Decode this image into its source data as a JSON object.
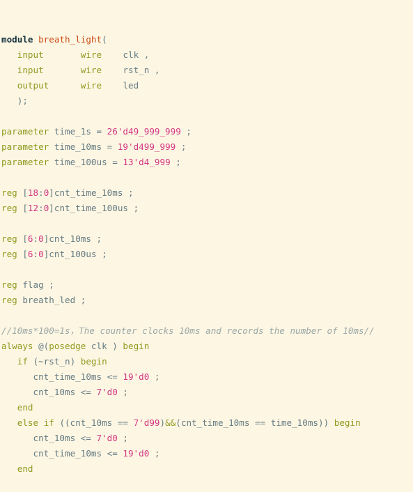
{
  "editor": {
    "language": "verilog",
    "theme": "solarized-light",
    "background_color": "#fdf6e3",
    "default_text_color": "#657b83",
    "font_size_px": 12.6,
    "line_height_px": 22,
    "palette": {
      "keyword": "#8f9a1e",
      "keyword_strong": "#17343f",
      "number": "#d33682",
      "module_name": "#cb4b16",
      "comment": "#9aa7a7",
      "operator": "#657b83",
      "punctuation": "#657b83"
    }
  },
  "code": {
    "plain_text": "module breath_light(\n   input       wire    clk ,\n   input       wire    rst_n ,\n   output      wire    led\n   );\n\nparameter time_1s = 26'd49_999_999 ;\nparameter time_10ms = 19'd499_999 ;\nparameter time_100us = 13'd4_999 ;\n\nreg [18:0]cnt_time_10ms ;\nreg [12:0]cnt_time_100us ;\n\nreg [6:0]cnt_10ms ;\nreg [6:0]cnt_100us ;\n\nreg flag ;\nreg breath_led ;\n\n//10ms*100=1s，The counter clocks 10ms and records the number of 10ms//\nalways @(posedge clk ) begin\n   if (~rst_n) begin\n      cnt_time_10ms <= 19'd0 ;\n      cnt_10ms <= 7'd0 ;\n   end\n   else if ((cnt_10ms == 7'd99)&&(cnt_time_10ms == time_10ms)) begin\n      cnt_10ms <= 7'd0 ;\n      cnt_time_10ms <= 19'd0 ;\n   end",
    "lines": [
      {
        "n": 1,
        "tokens": [
          {
            "t": "module",
            "c": "kw-strong"
          },
          {
            "t": " ",
            "c": "plain"
          },
          {
            "t": "breath_light",
            "c": "fn"
          },
          {
            "t": "(",
            "c": "punct"
          }
        ]
      },
      {
        "n": 2,
        "tokens": [
          {
            "t": "   ",
            "c": "plain"
          },
          {
            "t": "input",
            "c": "kw"
          },
          {
            "t": "       ",
            "c": "plain"
          },
          {
            "t": "wire",
            "c": "kw"
          },
          {
            "t": "    ",
            "c": "plain"
          },
          {
            "t": "clk ,",
            "c": "plain"
          }
        ]
      },
      {
        "n": 3,
        "tokens": [
          {
            "t": "   ",
            "c": "plain"
          },
          {
            "t": "input",
            "c": "kw"
          },
          {
            "t": "       ",
            "c": "plain"
          },
          {
            "t": "wire",
            "c": "kw"
          },
          {
            "t": "    ",
            "c": "plain"
          },
          {
            "t": "rst_n ,",
            "c": "plain"
          }
        ]
      },
      {
        "n": 4,
        "tokens": [
          {
            "t": "   ",
            "c": "plain"
          },
          {
            "t": "output",
            "c": "kw"
          },
          {
            "t": "      ",
            "c": "plain"
          },
          {
            "t": "wire",
            "c": "kw"
          },
          {
            "t": "    ",
            "c": "plain"
          },
          {
            "t": "led",
            "c": "plain"
          }
        ]
      },
      {
        "n": 5,
        "tokens": [
          {
            "t": "   );",
            "c": "plain"
          }
        ]
      },
      {
        "n": 6,
        "tokens": []
      },
      {
        "n": 7,
        "tokens": [
          {
            "t": "parameter",
            "c": "kw"
          },
          {
            "t": " time_1s = ",
            "c": "plain"
          },
          {
            "t": "26'd49_999_999",
            "c": "num"
          },
          {
            "t": " ;",
            "c": "plain"
          }
        ]
      },
      {
        "n": 8,
        "tokens": [
          {
            "t": "parameter",
            "c": "kw"
          },
          {
            "t": " time_10ms = ",
            "c": "plain"
          },
          {
            "t": "19'd499_999",
            "c": "num"
          },
          {
            "t": " ;",
            "c": "plain"
          }
        ]
      },
      {
        "n": 9,
        "tokens": [
          {
            "t": "parameter",
            "c": "kw"
          },
          {
            "t": " time_100us = ",
            "c": "plain"
          },
          {
            "t": "13'd4_999",
            "c": "num"
          },
          {
            "t": " ;",
            "c": "plain"
          }
        ]
      },
      {
        "n": 10,
        "tokens": []
      },
      {
        "n": 11,
        "tokens": [
          {
            "t": "reg",
            "c": "kw"
          },
          {
            "t": " [",
            "c": "plain"
          },
          {
            "t": "18",
            "c": "num"
          },
          {
            "t": ":",
            "c": "plain"
          },
          {
            "t": "0",
            "c": "num"
          },
          {
            "t": "]cnt_time_10ms ;",
            "c": "plain"
          }
        ]
      },
      {
        "n": 12,
        "tokens": [
          {
            "t": "reg",
            "c": "kw"
          },
          {
            "t": " [",
            "c": "plain"
          },
          {
            "t": "12",
            "c": "num"
          },
          {
            "t": ":",
            "c": "plain"
          },
          {
            "t": "0",
            "c": "num"
          },
          {
            "t": "]cnt_time_100us ;",
            "c": "plain"
          }
        ]
      },
      {
        "n": 13,
        "tokens": []
      },
      {
        "n": 14,
        "tokens": [
          {
            "t": "reg",
            "c": "kw"
          },
          {
            "t": " [",
            "c": "plain"
          },
          {
            "t": "6",
            "c": "num"
          },
          {
            "t": ":",
            "c": "plain"
          },
          {
            "t": "0",
            "c": "num"
          },
          {
            "t": "]cnt_10ms ;",
            "c": "plain"
          }
        ]
      },
      {
        "n": 15,
        "tokens": [
          {
            "t": "reg",
            "c": "kw"
          },
          {
            "t": " [",
            "c": "plain"
          },
          {
            "t": "6",
            "c": "num"
          },
          {
            "t": ":",
            "c": "plain"
          },
          {
            "t": "0",
            "c": "num"
          },
          {
            "t": "]cnt_100us ;",
            "c": "plain"
          }
        ]
      },
      {
        "n": 16,
        "tokens": []
      },
      {
        "n": 17,
        "tokens": [
          {
            "t": "reg",
            "c": "kw"
          },
          {
            "t": " flag ;",
            "c": "plain"
          }
        ]
      },
      {
        "n": 18,
        "tokens": [
          {
            "t": "reg",
            "c": "kw"
          },
          {
            "t": " breath_led ;",
            "c": "plain"
          }
        ]
      },
      {
        "n": 19,
        "tokens": []
      },
      {
        "n": 20,
        "tokens": [
          {
            "t": "//10ms*100=1s，The counter clocks 10ms and records the number of 10ms//",
            "c": "comment"
          }
        ]
      },
      {
        "n": 21,
        "tokens": [
          {
            "t": "always",
            "c": "kw"
          },
          {
            "t": " @(",
            "c": "plain"
          },
          {
            "t": "posedge",
            "c": "kw"
          },
          {
            "t": " clk ) ",
            "c": "plain"
          },
          {
            "t": "begin",
            "c": "kw"
          }
        ]
      },
      {
        "n": 22,
        "tokens": [
          {
            "t": "   ",
            "c": "plain"
          },
          {
            "t": "if",
            "c": "kw"
          },
          {
            "t": " (~rst_n) ",
            "c": "plain"
          },
          {
            "t": "begin",
            "c": "kw"
          }
        ]
      },
      {
        "n": 23,
        "tokens": [
          {
            "t": "      cnt_time_10ms <= ",
            "c": "plain"
          },
          {
            "t": "19'd0",
            "c": "num"
          },
          {
            "t": " ;",
            "c": "plain"
          }
        ]
      },
      {
        "n": 24,
        "tokens": [
          {
            "t": "      cnt_10ms <= ",
            "c": "plain"
          },
          {
            "t": "7'd0",
            "c": "num"
          },
          {
            "t": " ;",
            "c": "plain"
          }
        ]
      },
      {
        "n": 25,
        "tokens": [
          {
            "t": "   ",
            "c": "plain"
          },
          {
            "t": "end",
            "c": "kw"
          }
        ]
      },
      {
        "n": 26,
        "tokens": [
          {
            "t": "   ",
            "c": "plain"
          },
          {
            "t": "else",
            "c": "kw"
          },
          {
            "t": " ",
            "c": "plain"
          },
          {
            "t": "if",
            "c": "kw"
          },
          {
            "t": " ((cnt_10ms == ",
            "c": "plain"
          },
          {
            "t": "7'd99",
            "c": "num"
          },
          {
            "t": ")",
            "c": "plain"
          },
          {
            "t": "&&",
            "c": "kw"
          },
          {
            "t": "(cnt_time_10ms == time_10ms)) ",
            "c": "plain"
          },
          {
            "t": "begin",
            "c": "kw"
          }
        ]
      },
      {
        "n": 27,
        "tokens": [
          {
            "t": "      cnt_10ms <= ",
            "c": "plain"
          },
          {
            "t": "7'd0",
            "c": "num"
          },
          {
            "t": " ;",
            "c": "plain"
          }
        ]
      },
      {
        "n": 28,
        "tokens": [
          {
            "t": "      cnt_time_10ms <= ",
            "c": "plain"
          },
          {
            "t": "19'd0",
            "c": "num"
          },
          {
            "t": " ;",
            "c": "plain"
          }
        ]
      },
      {
        "n": 29,
        "tokens": [
          {
            "t": "   ",
            "c": "plain"
          },
          {
            "t": "end",
            "c": "kw"
          }
        ]
      }
    ]
  }
}
